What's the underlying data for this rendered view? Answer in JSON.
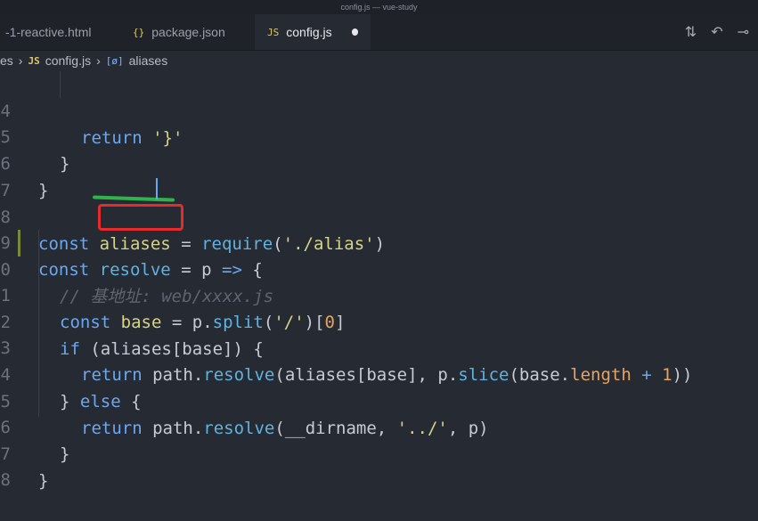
{
  "window": {
    "title": "config.js — vue-study"
  },
  "tabs": [
    {
      "label": "-1-reactive.html",
      "icon": ""
    },
    {
      "label": "package.json",
      "icon": "{}"
    },
    {
      "label": "config.js",
      "icon": "JS"
    }
  ],
  "breadcrumb": {
    "folder": "es",
    "file_icon": "JS",
    "file": "config.js",
    "symbol_icon": "[ø]",
    "symbol": "aliases"
  },
  "code": {
    "line_numbers": [
      "4",
      "5",
      "6",
      "7",
      "8",
      "9",
      "0",
      "1",
      "2",
      "3",
      "4",
      "5",
      "6",
      "7",
      "8"
    ],
    "l4": [
      "return",
      "'}'"
    ],
    "l8": [
      "const",
      "aliases",
      "=",
      "require",
      "(",
      "'./alias'",
      ")"
    ],
    "l9": [
      "const",
      "resolve",
      "=",
      "p",
      "=>",
      "{"
    ],
    "l10": "// 基地址: web/xxxx.js",
    "l11": [
      "const",
      "base",
      "=",
      "p.",
      "split",
      "(",
      "'/'",
      ")[",
      "0",
      "]"
    ],
    "l12": [
      "if",
      "(aliases[base]) {"
    ],
    "l13": [
      "return",
      "path.",
      "resolve",
      "(aliases[base], p.",
      "slice",
      "(base.",
      "length",
      "+",
      "1",
      "))"
    ],
    "l14": [
      "} ",
      "else",
      " {"
    ],
    "l15": [
      "return",
      "path.",
      "resolve",
      "(__dirname, ",
      "'../'",
      ", p)"
    ],
    "brace_close": "}",
    "brace_close_paren": "}"
  }
}
